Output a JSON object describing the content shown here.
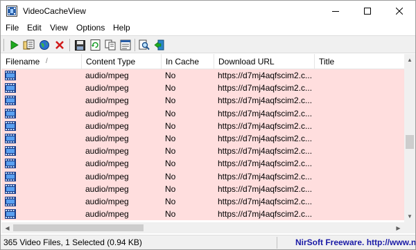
{
  "window": {
    "title": "VideoCacheView"
  },
  "menu": [
    "File",
    "Edit",
    "View",
    "Options",
    "Help"
  ],
  "toolbar": {
    "buttons": [
      "play-icon",
      "copy-files-icon",
      "open-url-icon",
      "delete-icon",
      "save-icon",
      "refresh-icon",
      "copy-icon",
      "properties-icon",
      "find-icon",
      "exit-icon"
    ]
  },
  "columns": [
    "Filename",
    "Content Type",
    "In Cache",
    "Download URL",
    "Title"
  ],
  "sort_indicator": "/",
  "rows": [
    {
      "type": "audio/mpeg",
      "cache": "No",
      "url": "https://d7mj4aqfscim2.c..."
    },
    {
      "type": "audio/mpeg",
      "cache": "No",
      "url": "https://d7mj4aqfscim2.c..."
    },
    {
      "type": "audio/mpeg",
      "cache": "No",
      "url": "https://d7mj4aqfscim2.c..."
    },
    {
      "type": "audio/mpeg",
      "cache": "No",
      "url": "https://d7mj4aqfscim2.c..."
    },
    {
      "type": "audio/mpeg",
      "cache": "No",
      "url": "https://d7mj4aqfscim2.c..."
    },
    {
      "type": "audio/mpeg",
      "cache": "No",
      "url": "https://d7mj4aqfscim2.c..."
    },
    {
      "type": "audio/mpeg",
      "cache": "No",
      "url": "https://d7mj4aqfscim2.c..."
    },
    {
      "type": "audio/mpeg",
      "cache": "No",
      "url": "https://d7mj4aqfscim2.c..."
    },
    {
      "type": "audio/mpeg",
      "cache": "No",
      "url": "https://d7mj4aqfscim2.c..."
    },
    {
      "type": "audio/mpeg",
      "cache": "No",
      "url": "https://d7mj4aqfscim2.c..."
    },
    {
      "type": "audio/mpeg",
      "cache": "No",
      "url": "https://d7mj4aqfscim2.c..."
    },
    {
      "type": "audio/mpeg",
      "cache": "No",
      "url": "https://d7mj4aqfscim2.c..."
    }
  ],
  "status": {
    "left": "365 Video Files, 1 Selected  (0.94 KB)",
    "right": "NirSoft Freeware.  http://www.nirsof"
  },
  "colors": {
    "row_background": "#ffdede",
    "status_link": "#1a1aa6"
  }
}
